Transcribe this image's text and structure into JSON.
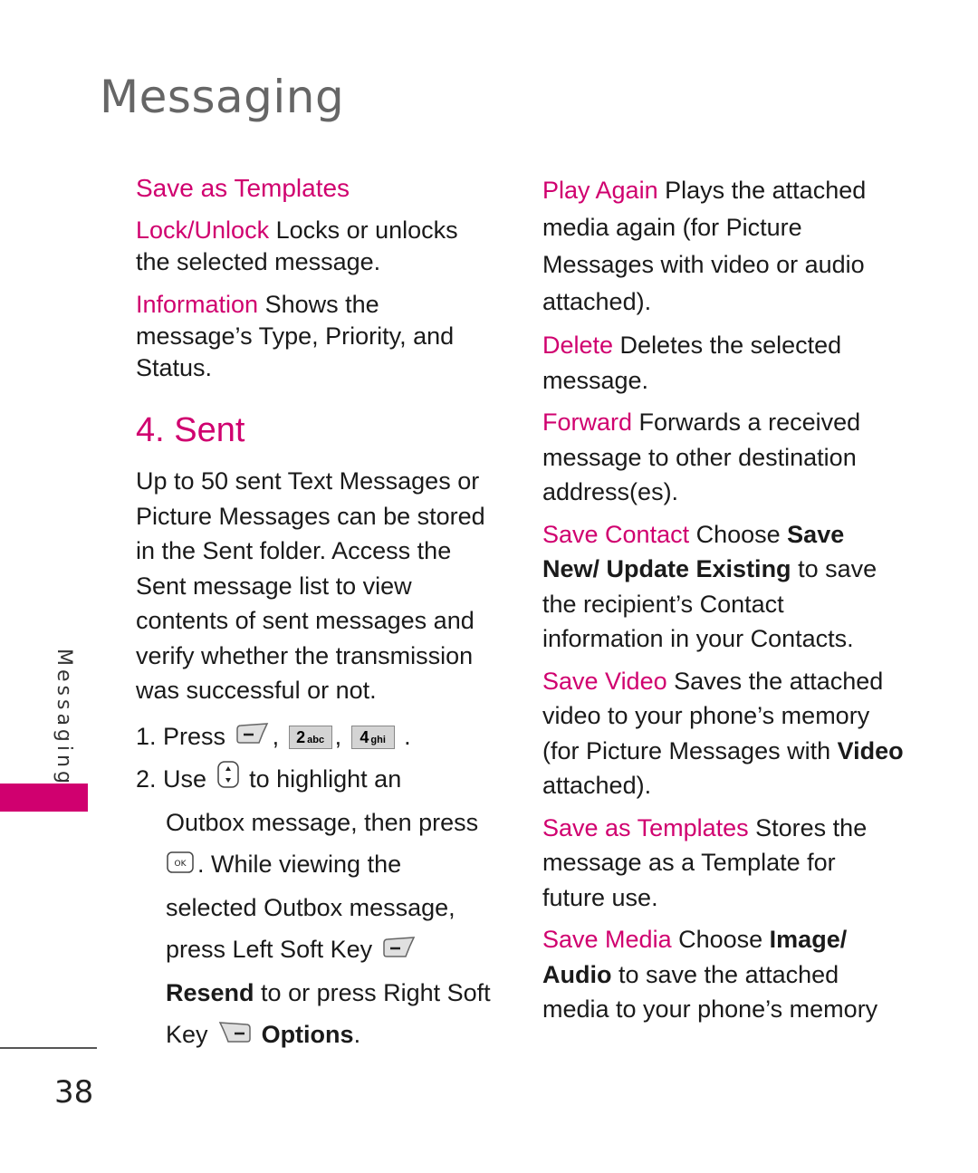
{
  "header": {
    "title": "Messaging"
  },
  "left_column": {
    "items": [
      {
        "label": "Save as Templates",
        "text": ""
      },
      {
        "label": "Lock/Unlock",
        "text": " Locks or unlocks the selected message."
      },
      {
        "label": "Information",
        "text": " Shows the message’s Type, Priority, and Status."
      }
    ],
    "section_title": "4. Sent",
    "section_body": "Up to 50 sent Text Messages or Picture Messages can be stored in the Sent folder. Access the Sent message list to view contents of sent messages and verify whether the transmission was successful or not.",
    "steps": {
      "step1_prefix": "1. Press",
      "step1_sep1": ",",
      "step1_sep2": ",",
      "step1_end": ".",
      "key_2_num": "2",
      "key_2_letters": "abc",
      "key_4_num": "4",
      "key_4_letters": "ghi",
      "step2_prefix": "2. Use",
      "step2_a": "to highlight an",
      "step2_b": "Outbox message, then press",
      "step2_c": ". While viewing the",
      "step2_d": "selected Outbox message,",
      "step2_e": "press Left Soft Key",
      "step2_resend": "Resend",
      "step2_f": " to or press Right Soft",
      "step2_key": "Key",
      "step2_options": "Options",
      "step2_end": "."
    }
  },
  "right_column": {
    "items": [
      {
        "label": "Play Again",
        "text": " Plays the attached media again (for Picture Messages with video or audio attached)."
      },
      {
        "label": "Delete",
        "text": " Deletes the selected message."
      },
      {
        "label": "Forward",
        "text": " Forwards a received message to other destination address(es)."
      }
    ],
    "save_contact": {
      "label": "Save Contact",
      "t1": " Choose ",
      "b1": "Save New/ Update Existing",
      "t2": " to save the recipient’s Contact information in your Contacts."
    },
    "save_video": {
      "label": "Save Video",
      "t1": " Saves the attached video to your phone’s memory (for Picture Messages with ",
      "b1": "Video",
      "t2": " attached)."
    },
    "save_templates": {
      "label": "Save as Templates",
      "text": " Stores the message as a Template for future use."
    },
    "save_media": {
      "label": "Save Media",
      "t1": " Choose ",
      "b1": "Image/ Audio",
      "t2": " to save the attached media to your phone’s memory"
    }
  },
  "sidebar": {
    "tab_label": "Messaging",
    "page_number": "38"
  },
  "colors": {
    "accent": "#d0006f",
    "title_gray": "#666666",
    "text": "#1a1a1a"
  },
  "icons": {
    "left_soft_key": "left-soft-key-icon",
    "right_soft_key": "right-soft-key-icon",
    "nav_key": "up-down-nav-key-icon",
    "ok_key": "ok-key-icon"
  }
}
